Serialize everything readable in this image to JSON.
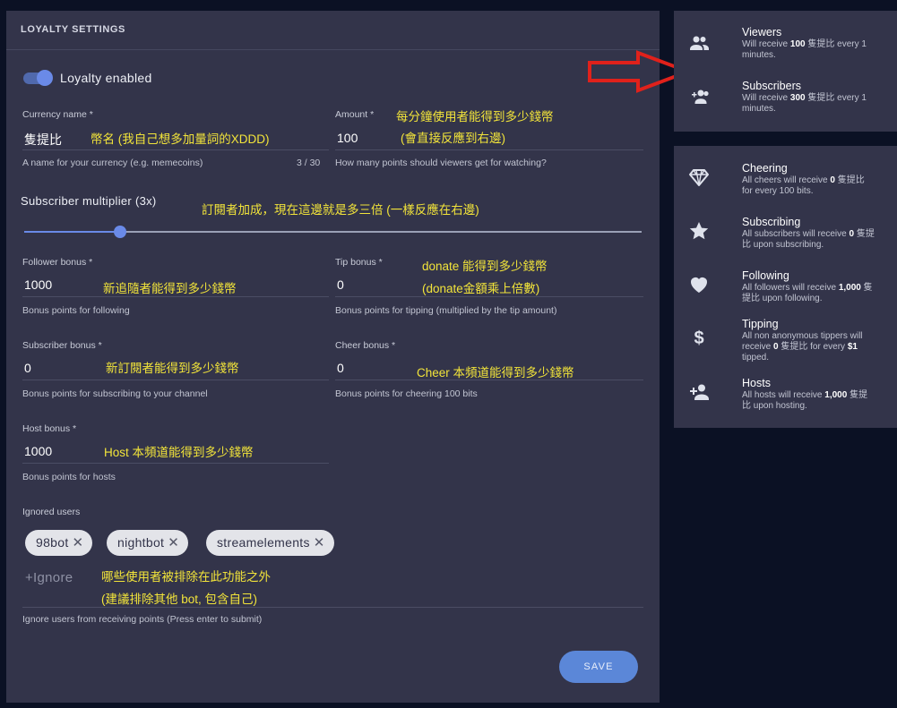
{
  "panel": {
    "title": "LOYALTY SETTINGS"
  },
  "toggle": {
    "label": "Loyalty enabled",
    "enabled": true
  },
  "currency": {
    "label": "Currency name *",
    "value": "隻提比",
    "hint": "A name for your currency (e.g. memecoins)",
    "counter": "3 / 30",
    "note": "幣名 (我自己想多加量詞的XDDD)"
  },
  "amount": {
    "label": "Amount *",
    "value": "100",
    "hint": "How many points should viewers get for watching?",
    "note1": "每分鐘使用者能得到多少錢幣",
    "note2": "(會直接反應到右邊)"
  },
  "multiplier": {
    "label": "Subscriber multiplier (3x)",
    "value": 3,
    "min": 1,
    "max": 10,
    "note": "訂閱者加成，現在這邊就是多三倍 (一樣反應在右邊)"
  },
  "follower": {
    "label": "Follower bonus *",
    "value": "1000",
    "hint": "Bonus points for following",
    "note": "新追隨者能得到多少錢幣"
  },
  "tip": {
    "label": "Tip bonus *",
    "value": "0",
    "hint": "Bonus points for tipping (multiplied by the tip amount)",
    "note1": "donate 能得到多少錢幣",
    "note2": "(donate金額乘上倍數)"
  },
  "subscriber": {
    "label": "Subscriber bonus *",
    "value": "0",
    "hint": "Bonus points for subscribing to your channel",
    "note": "新訂閱者能得到多少錢幣"
  },
  "cheer": {
    "label": "Cheer bonus *",
    "value": "0",
    "hint": "Bonus points for cheering 100 bits",
    "note": "Cheer 本頻道能得到多少錢幣"
  },
  "host": {
    "label": "Host bonus *",
    "value": "1000",
    "hint": "Bonus points for hosts",
    "note": "Host 本頻道能得到多少錢幣"
  },
  "ignored": {
    "label": "Ignored users",
    "chips": [
      "98bot",
      "nightbot",
      "streamelements"
    ],
    "remove_glyph": "✕",
    "input_value": "+Ignore",
    "hint": "Ignore users from receiving points (Press enter to submit)",
    "note1": "哪些使用者被排除在此功能之外",
    "note2": "(建議排除其他 bot, 包含自己)"
  },
  "save_label": "SAVE",
  "right_top": [
    {
      "icon": "viewers-icon",
      "title": "Viewers",
      "line1_pre": "Will receive ",
      "line1_bold": "100",
      "line1_post": " 隻提比 every 1",
      "line2": "minutes."
    },
    {
      "icon": "subscribers-icon",
      "title": "Subscribers",
      "line1_pre": "Will receive ",
      "line1_bold": "300",
      "line1_post": " 隻提比 every 1",
      "line2": "minutes."
    }
  ],
  "right_bottom": [
    {
      "icon": "diamond-icon",
      "title": "Cheering",
      "line1_pre": "All cheers will receive ",
      "line1_bold": "0",
      "line1_post": " 隻提比",
      "line2": "for every 100 bits."
    },
    {
      "icon": "star-icon",
      "title": "Subscribing",
      "line1_pre": "All subscribers will receive ",
      "line1_bold": "0",
      "line1_post": " 隻提",
      "line2": "比 upon subscribing."
    },
    {
      "icon": "heart-icon",
      "title": "Following",
      "line1_pre": "All followers will receive ",
      "line1_bold": "1,000",
      "line1_post": " 隻",
      "line2": "提比 upon following."
    },
    {
      "icon": "dollar-icon",
      "title": "Tipping",
      "line1_pre": "All non anonymous tippers will",
      "line1_bold": "",
      "line1_post": "",
      "line2_pre": "receive ",
      "line2_bold": "0",
      "line2_mid": " 隻提比 for every ",
      "line2_bold2": "$1",
      "line3": "tipped."
    },
    {
      "icon": "host-icon",
      "title": "Hosts",
      "line1_pre": "All hosts will receive ",
      "line1_bold": "1,000",
      "line1_post": " 隻提",
      "line2": "比 upon hosting."
    }
  ],
  "colors": {
    "accent": "#6a8ae8",
    "note": "#f2e43a",
    "arrow": "#e0211b",
    "panel": "#33344a",
    "background": "#0b1124"
  }
}
